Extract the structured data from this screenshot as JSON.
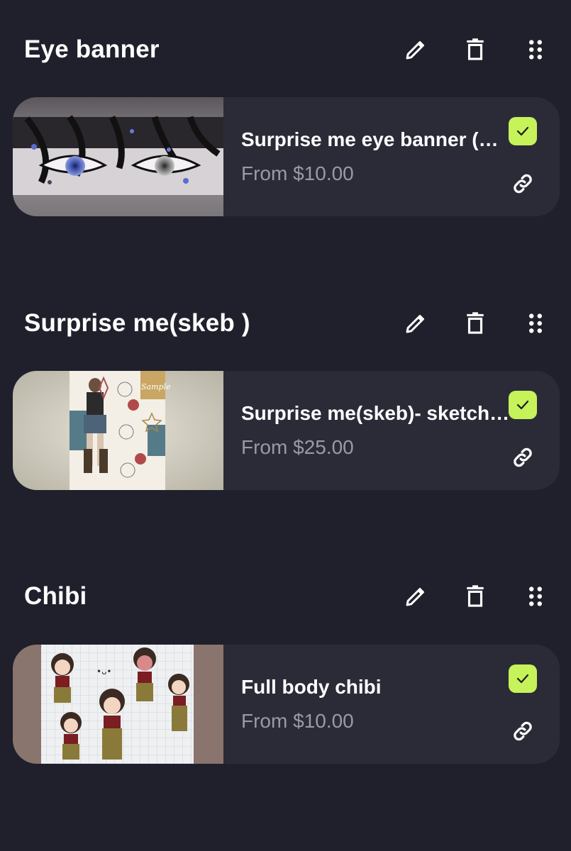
{
  "sections": [
    {
      "title": "Eye banner",
      "item": {
        "title": "Surprise me eye banner (…",
        "price": "From $10.00",
        "thumbnail": "eye-banner-artwork"
      }
    },
    {
      "title": "Surprise me(skeb )",
      "item": {
        "title": "Surprise me(skeb)- sketch…",
        "price": "From $25.00",
        "thumbnail": "sketch-sample-artwork",
        "thumbnail_text": "Sample"
      }
    },
    {
      "title": "Chibi",
      "item": {
        "title": "Full body chibi",
        "price": "From $10.00",
        "thumbnail": "chibi-artwork"
      }
    }
  ],
  "icons": {
    "edit": "pencil-icon",
    "delete": "trash-icon",
    "drag": "drag-handle-icon",
    "checked": "check-icon",
    "link": "link-icon"
  },
  "colors": {
    "background": "#20202c",
    "card": "#2b2b38",
    "accent": "#c6f25a",
    "muted_text": "#9a9aa6"
  }
}
